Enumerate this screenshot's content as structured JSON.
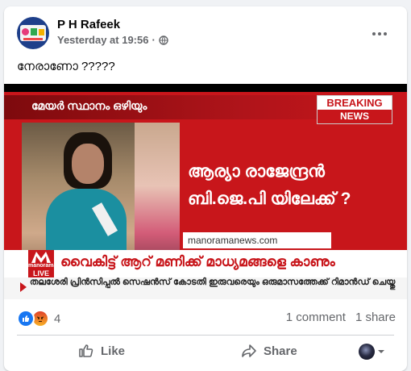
{
  "post": {
    "author": "P H Rafeek",
    "time": "Yesterday at 19:56",
    "separator": "·",
    "audience_icon": "globe-icon",
    "text": "നേരാണോ ?????"
  },
  "media": {
    "kicker": "മേയർ സ്ഥാനം ഒഴിയും",
    "breaking_top": "BREAKING",
    "breaking_bottom": "NEWS",
    "headline_line1": "ആര്യാ രാജേന്ദ്രൻ",
    "headline_line2": "ബി.ജെ.പി യിലേക്ക് ?",
    "site": "manoramanews.com",
    "logo_line1": "manorama",
    "logo_line2": "LIVE",
    "lower_third": "വൈകിട്ട് ആറ് മണിക്ക് മാധ്യമങ്ങളെ കാണും",
    "ticker": "തലശേരി പ്രിൻസിപ്പൽ സെഷൻസ് കോടതി ഇരുവരെയും ഒരുമാസത്തേക്ക് റിമാൻഡ് ചെയ്തു",
    "accent": "#c8161b"
  },
  "engagement": {
    "reaction_count": "4",
    "comments": "1 comment",
    "shares": "1 share"
  },
  "actions": {
    "like": "Like",
    "share": "Share"
  }
}
